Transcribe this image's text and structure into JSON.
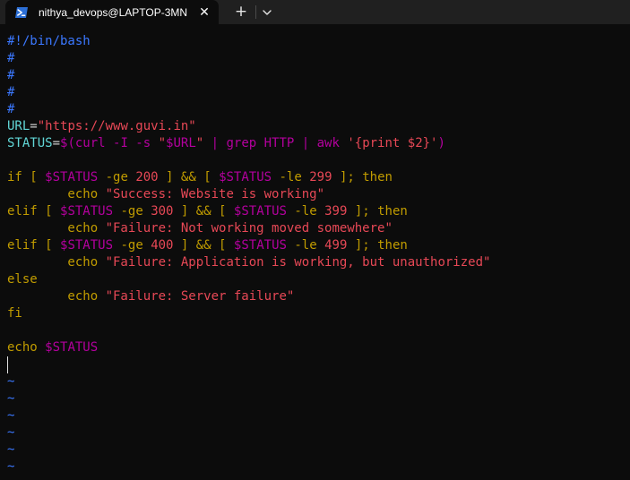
{
  "window": {
    "tab_title": "nithya_devops@LAPTOP-3MN",
    "tab_icon": "powershell-icon",
    "close_icon": "close-icon",
    "new_tab_icon": "plus-icon",
    "dropdown_icon": "chevron-down-icon"
  },
  "colors": {
    "background": "#0c0c0c",
    "titlebar": "#202020",
    "comment": "#3b78ff",
    "variable": "#61d6d6",
    "string": "#e74856",
    "keyword": "#c19c00",
    "parameter": "#b4009e"
  },
  "script": {
    "lines": [
      [
        {
          "t": "#!/bin/bash",
          "c": "comment"
        }
      ],
      [
        {
          "t": "#",
          "c": "comment"
        }
      ],
      [
        {
          "t": "#",
          "c": "comment"
        }
      ],
      [
        {
          "t": "#",
          "c": "comment"
        }
      ],
      [
        {
          "t": "#",
          "c": "comment"
        }
      ],
      [
        {
          "t": "URL",
          "c": "var"
        },
        {
          "t": "=",
          "c": "plain"
        },
        {
          "t": "\"https://www.guvi.in\"",
          "c": "str"
        }
      ],
      [
        {
          "t": "STATUS",
          "c": "var"
        },
        {
          "t": "=",
          "c": "plain"
        },
        {
          "t": "$(curl -I -s ",
          "c": "param"
        },
        {
          "t": "\"",
          "c": "str"
        },
        {
          "t": "$URL",
          "c": "param"
        },
        {
          "t": "\"",
          "c": "str"
        },
        {
          "t": " | grep HTTP | awk ",
          "c": "param"
        },
        {
          "t": "'{print $2}'",
          "c": "str"
        },
        {
          "t": ")",
          "c": "param"
        }
      ],
      [],
      [
        {
          "t": "if [ ",
          "c": "kw"
        },
        {
          "t": "$STATUS",
          "c": "param"
        },
        {
          "t": " -ge ",
          "c": "kw"
        },
        {
          "t": "200",
          "c": "str"
        },
        {
          "t": " ] && [ ",
          "c": "kw"
        },
        {
          "t": "$STATUS",
          "c": "param"
        },
        {
          "t": " -le ",
          "c": "kw"
        },
        {
          "t": "299",
          "c": "str"
        },
        {
          "t": " ]; then",
          "c": "kw"
        }
      ],
      [
        {
          "t": "        echo ",
          "c": "kw"
        },
        {
          "t": "\"Success: Website is working\"",
          "c": "str"
        }
      ],
      [
        {
          "t": "elif [ ",
          "c": "kw"
        },
        {
          "t": "$STATUS",
          "c": "param"
        },
        {
          "t": " -ge ",
          "c": "kw"
        },
        {
          "t": "300",
          "c": "str"
        },
        {
          "t": " ] && [ ",
          "c": "kw"
        },
        {
          "t": "$STATUS",
          "c": "param"
        },
        {
          "t": " -le ",
          "c": "kw"
        },
        {
          "t": "399",
          "c": "str"
        },
        {
          "t": " ]; then",
          "c": "kw"
        }
      ],
      [
        {
          "t": "        echo ",
          "c": "kw"
        },
        {
          "t": "\"Failure: Not working moved somewhere\"",
          "c": "str"
        }
      ],
      [
        {
          "t": "elif [ ",
          "c": "kw"
        },
        {
          "t": "$STATUS",
          "c": "param"
        },
        {
          "t": " -ge ",
          "c": "kw"
        },
        {
          "t": "400",
          "c": "str"
        },
        {
          "t": " ] && [ ",
          "c": "kw"
        },
        {
          "t": "$STATUS",
          "c": "param"
        },
        {
          "t": " -le ",
          "c": "kw"
        },
        {
          "t": "499",
          "c": "str"
        },
        {
          "t": " ]; then",
          "c": "kw"
        }
      ],
      [
        {
          "t": "        echo ",
          "c": "kw"
        },
        {
          "t": "\"Failure: Application is working, but unauthorized\"",
          "c": "str"
        }
      ],
      [
        {
          "t": "else",
          "c": "kw"
        }
      ],
      [
        {
          "t": "        echo ",
          "c": "kw"
        },
        {
          "t": "\"Failure: Server failure\"",
          "c": "str"
        }
      ],
      [
        {
          "t": "fi",
          "c": "kw"
        }
      ],
      [],
      [
        {
          "t": "echo ",
          "c": "kw"
        },
        {
          "t": "$STATUS",
          "c": "param"
        }
      ],
      [
        {
          "cursor": true
        }
      ],
      [
        {
          "t": "~",
          "c": "tilde"
        }
      ],
      [
        {
          "t": "~",
          "c": "tilde"
        }
      ],
      [
        {
          "t": "~",
          "c": "tilde"
        }
      ],
      [
        {
          "t": "~",
          "c": "tilde"
        }
      ],
      [
        {
          "t": "~",
          "c": "tilde"
        }
      ],
      [
        {
          "t": "~",
          "c": "tilde"
        }
      ]
    ]
  }
}
